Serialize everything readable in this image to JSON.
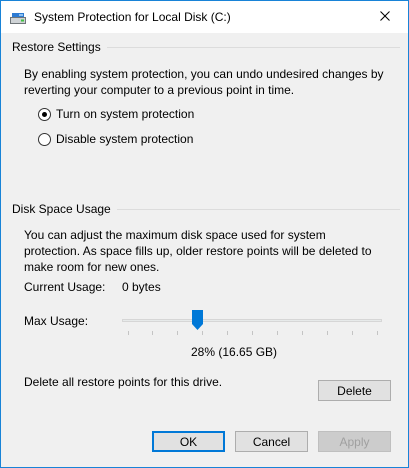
{
  "window": {
    "title": "System Protection for Local Disk (C:)",
    "accent_color": "#1883d7",
    "icon": "drive-icon",
    "close_icon": "close-icon"
  },
  "restore_settings": {
    "header": "Restore Settings",
    "description": "By enabling system protection, you can undo undesired changes by reverting your computer to a previous point in time.",
    "options": [
      {
        "label": "Turn on system protection",
        "selected": true
      },
      {
        "label": "Disable system protection",
        "selected": false
      }
    ]
  },
  "disk_space": {
    "header": "Disk Space Usage",
    "description": "You can adjust the maximum disk space used for system protection. As space fills up, older restore points will be deleted to make room for new ones.",
    "current_usage_label": "Current Usage:",
    "current_usage_value": "0 bytes",
    "max_usage_label": "Max Usage:",
    "max_usage_percent": 28,
    "max_usage_display": "28% (16.65 GB)",
    "thumb_color": "#0078d7"
  },
  "delete_section": {
    "text": "Delete all restore points for this drive.",
    "button_label": "Delete"
  },
  "footer": {
    "ok_label": "OK",
    "cancel_label": "Cancel",
    "apply_label": "Apply"
  }
}
